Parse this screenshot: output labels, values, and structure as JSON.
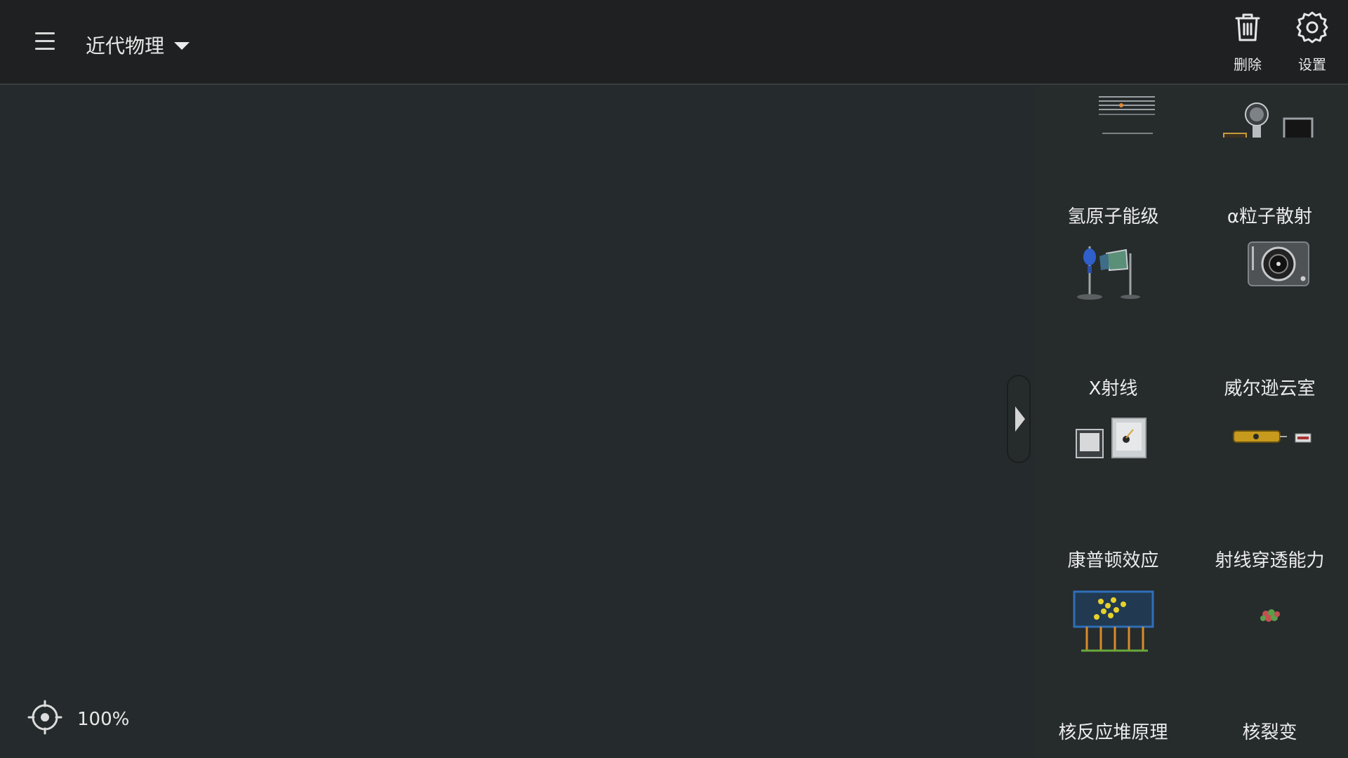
{
  "header": {
    "category": "近代物理",
    "delete_label": "删除",
    "settings_label": "设置"
  },
  "workspace": {
    "zoom": "100%"
  },
  "experiments": [
    {
      "label": "氢原子能级",
      "icon": "hydrogen-energy-levels-icon"
    },
    {
      "label": "α粒子散射",
      "icon": "alpha-scattering-icon"
    },
    {
      "label": "X射线",
      "icon": "xray-apparatus-icon"
    },
    {
      "label": "威尔逊云室",
      "icon": "cloud-chamber-icon"
    },
    {
      "label": "康普顿效应",
      "icon": "compton-effect-icon"
    },
    {
      "label": "射线穿透能力",
      "icon": "ray-penetration-icon"
    },
    {
      "label": "核反应堆原理",
      "icon": "nuclear-reactor-icon"
    },
    {
      "label": "核裂变",
      "icon": "nuclear-fission-icon"
    }
  ]
}
